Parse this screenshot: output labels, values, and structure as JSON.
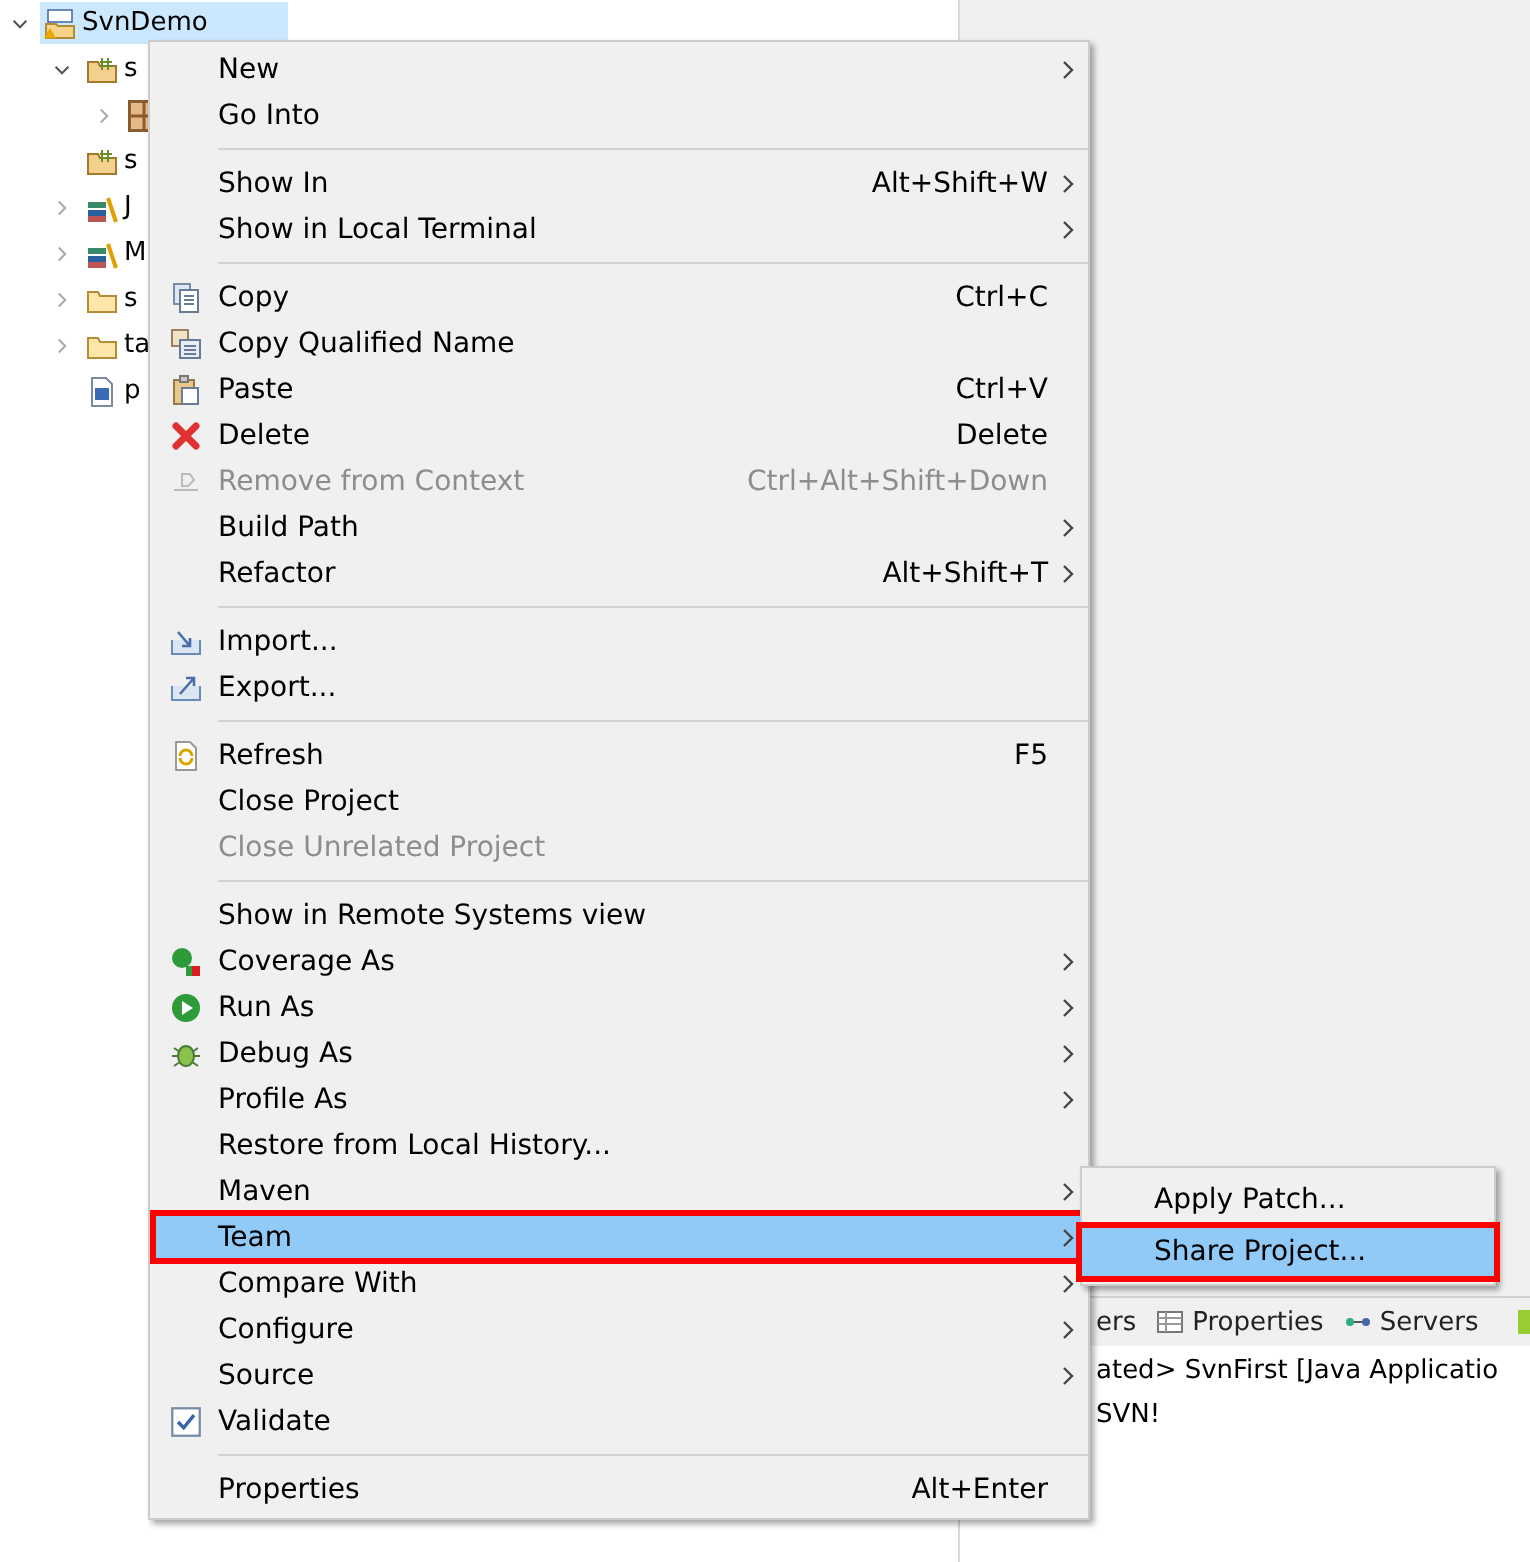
{
  "tree": {
    "items": [
      {
        "label": "SvnDemo",
        "kind": "project",
        "expanded": true,
        "selected": true,
        "children": [
          {
            "label": "s",
            "kind": "source-folder",
            "expanded": true,
            "selected": false,
            "children": [
              {
                "kind": "package",
                "expanded": false,
                "selected": false
              }
            ]
          },
          {
            "label": "s",
            "kind": "source-folder",
            "selected": false
          },
          {
            "label": "J",
            "kind": "library",
            "expanded": false,
            "selected": false
          },
          {
            "label": "M",
            "kind": "library",
            "expanded": false,
            "selected": false
          },
          {
            "label": "s",
            "kind": "folder",
            "expanded": false,
            "selected": false
          },
          {
            "label": "ta",
            "kind": "folder",
            "expanded": false,
            "selected": false
          },
          {
            "label": "p",
            "kind": "file",
            "selected": false
          }
        ]
      }
    ]
  },
  "bottom_panel": {
    "tabs": [
      {
        "label": "ers",
        "kind": "plain"
      },
      {
        "label": "Properties",
        "kind": "table"
      },
      {
        "label": "Servers",
        "kind": "servers"
      }
    ],
    "lines": [
      "ated> SvnFirst [Java Applicatio",
      "SVN!"
    ]
  },
  "context_menu": {
    "items": [
      {
        "kind": "item",
        "label": "New",
        "submenu": true
      },
      {
        "kind": "item",
        "label": "Go Into"
      },
      {
        "kind": "separator"
      },
      {
        "kind": "item",
        "label": "Show In",
        "shortcut": "Alt+Shift+W",
        "submenu": true
      },
      {
        "kind": "item",
        "label": "Show in Local Terminal",
        "submenu": true
      },
      {
        "kind": "separator"
      },
      {
        "kind": "copy",
        "label": "Copy",
        "shortcut": "Ctrl+C"
      },
      {
        "kind": "copyname",
        "label": "Copy Qualified Name"
      },
      {
        "kind": "paste",
        "label": "Paste",
        "shortcut": "Ctrl+V"
      },
      {
        "kind": "delete",
        "label": "Delete",
        "shortcut": "Delete"
      },
      {
        "kind": "remove",
        "label": "Remove from Context",
        "shortcut": "Ctrl+Alt+Shift+Down",
        "disabled": true
      },
      {
        "kind": "item",
        "label": "Build Path",
        "submenu": true
      },
      {
        "kind": "item",
        "label": "Refactor",
        "shortcut": "Alt+Shift+T",
        "submenu": true
      },
      {
        "kind": "separator"
      },
      {
        "kind": "import",
        "label": "Import..."
      },
      {
        "kind": "export",
        "label": "Export..."
      },
      {
        "kind": "separator"
      },
      {
        "kind": "refresh",
        "label": "Refresh",
        "shortcut": "F5"
      },
      {
        "kind": "item",
        "label": "Close Project",
        "disabled": false
      },
      {
        "kind": "item",
        "label": "Close Unrelated Project",
        "disabled": true
      },
      {
        "kind": "separator"
      },
      {
        "kind": "item",
        "label": "Show in Remote Systems view"
      },
      {
        "kind": "coverage",
        "label": "Coverage As",
        "submenu": true
      },
      {
        "kind": "run",
        "label": "Run As",
        "submenu": true
      },
      {
        "kind": "debug",
        "label": "Debug As",
        "submenu": true
      },
      {
        "kind": "item",
        "label": "Profile As",
        "submenu": true
      },
      {
        "kind": "item",
        "label": "Restore from Local History..."
      },
      {
        "kind": "item",
        "label": "Maven",
        "submenu": true,
        "selected": false
      },
      {
        "kind": "item",
        "label": "Team",
        "submenu": true,
        "selected": true,
        "annotated": true
      },
      {
        "kind": "item",
        "label": "Compare With",
        "submenu": true
      },
      {
        "kind": "item",
        "label": "Configure",
        "submenu": true
      },
      {
        "kind": "item",
        "label": "Source",
        "submenu": true
      },
      {
        "kind": "checkbox",
        "label": "Validate",
        "checked": true
      },
      {
        "kind": "separator"
      },
      {
        "kind": "item",
        "label": "Properties",
        "shortcut": "Alt+Enter"
      }
    ]
  },
  "submenu": {
    "items": [
      {
        "label": "Apply Patch...",
        "selected": false,
        "annotated": false
      },
      {
        "label": "Share Project...",
        "selected": true,
        "annotated": true
      }
    ]
  }
}
